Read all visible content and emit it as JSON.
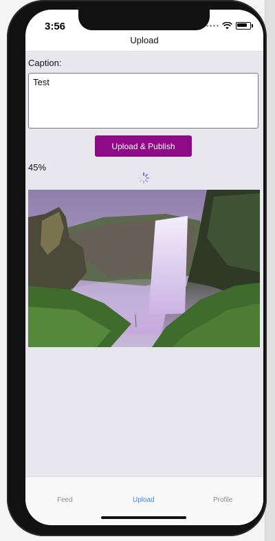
{
  "status": {
    "time": "3:56"
  },
  "nav": {
    "title": "Upload"
  },
  "form": {
    "caption_label": "Caption:",
    "caption_value": "Test",
    "publish_label": "Upload & Publish",
    "progress_text": "45%",
    "progress_value": 0.45
  },
  "image": {
    "description_icon": "waterfall-photo"
  },
  "tabs": [
    {
      "label": "Feed"
    },
    {
      "label": "Upload"
    },
    {
      "label": "Profile"
    }
  ],
  "colors": {
    "accent": "#8e0a86",
    "active_tab": "#3b82f6",
    "background": "#e8e7ee"
  }
}
